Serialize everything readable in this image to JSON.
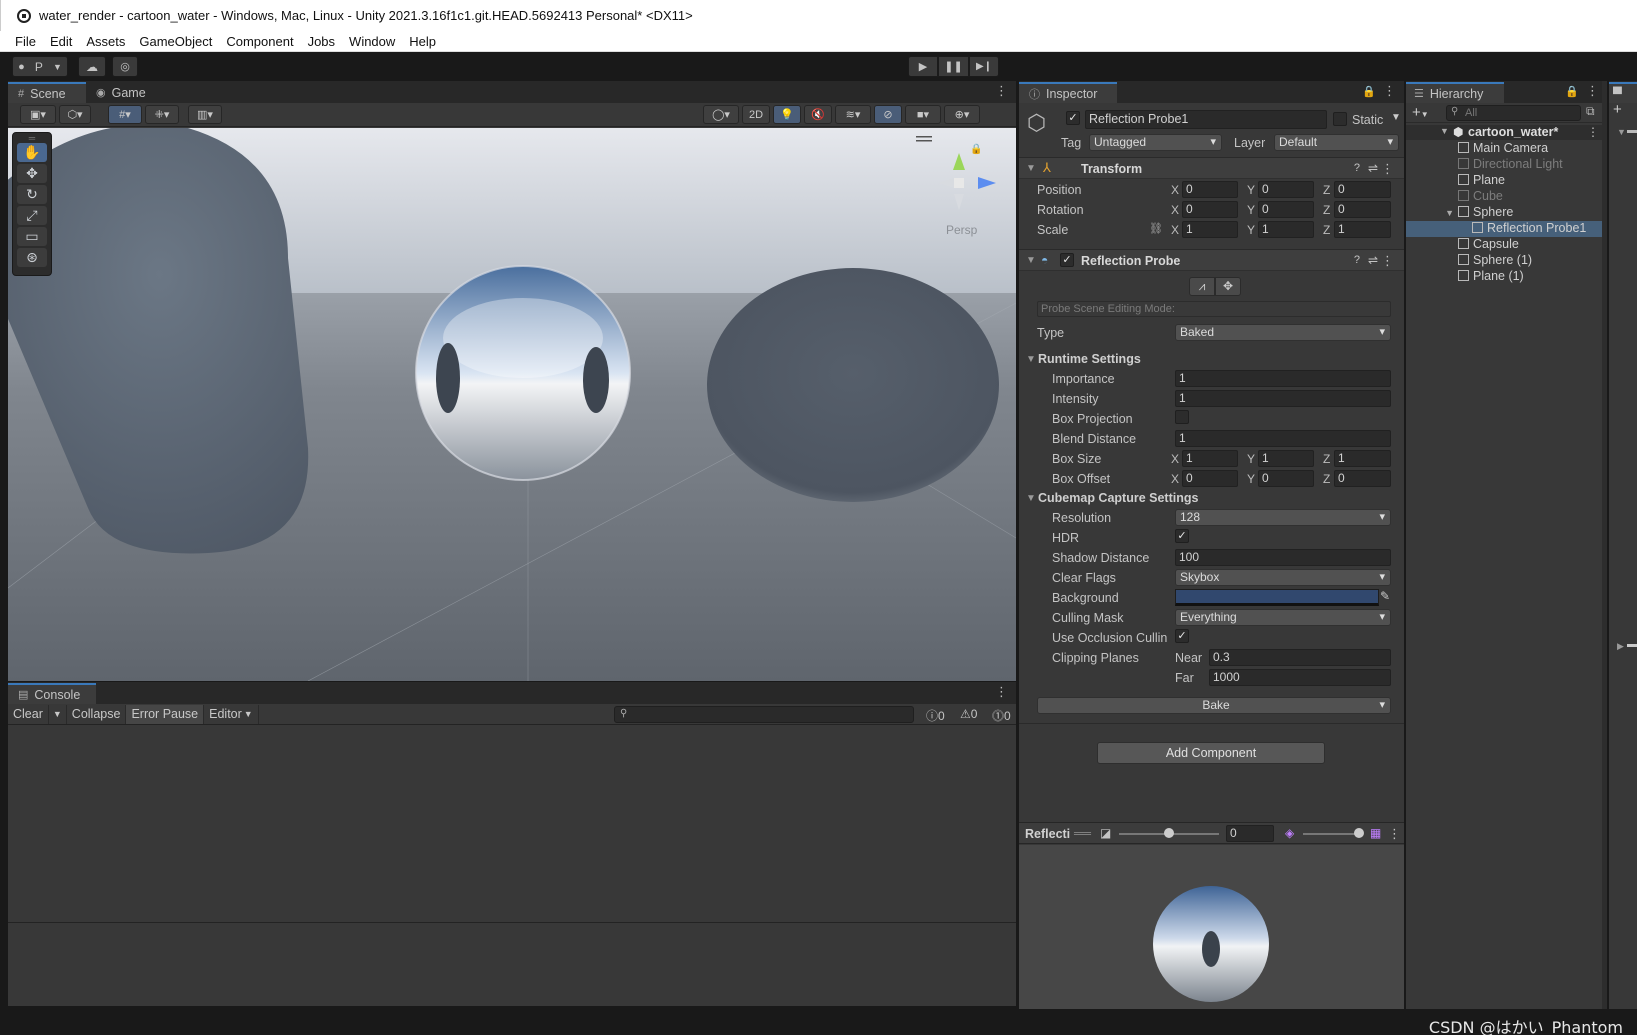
{
  "window": {
    "title": "water_render - cartoon_water - Windows, Mac, Linux - Unity 2021.3.16f1c1.git.HEAD.5692413 Personal* <DX11>"
  },
  "menu": [
    "File",
    "Edit",
    "Assets",
    "GameObject",
    "Component",
    "Jobs",
    "Window",
    "Help"
  ],
  "toolbar": {
    "account": "P",
    "play_icon": "play-icon",
    "pause_icon": "pause-icon",
    "step_icon": "step-icon"
  },
  "scene": {
    "tabs": [
      "Scene",
      "Game"
    ],
    "active_tab": "Scene",
    "toggle_2d": "2D",
    "camera_label": "Persp"
  },
  "console": {
    "tab": "Console",
    "clear": "Clear",
    "collapse": "Collapse",
    "error_pause": "Error Pause",
    "editor": "Editor",
    "search_placeholder": "",
    "log_count": "0",
    "warn_count": "0",
    "error_count": "0"
  },
  "inspector": {
    "tab": "Inspector",
    "object_name": "Reflection Probe1",
    "static_label": "Static",
    "tag_label": "Tag",
    "tag_value": "Untagged",
    "layer_label": "Layer",
    "layer_value": "Default",
    "transform": {
      "title": "Transform",
      "position_label": "Position",
      "rotation_label": "Rotation",
      "scale_label": "Scale",
      "position": {
        "x": "0",
        "y": "0",
        "z": "0"
      },
      "rotation": {
        "x": "0",
        "y": "0",
        "z": "0"
      },
      "scale": {
        "x": "1",
        "y": "1",
        "z": "1"
      }
    },
    "probe": {
      "title": "Reflection Probe",
      "editing_mode": "Probe Scene Editing Mode:",
      "type_label": "Type",
      "type_value": "Baked",
      "runtime_header": "Runtime Settings",
      "importance_label": "Importance",
      "importance": "1",
      "intensity_label": "Intensity",
      "intensity": "1",
      "box_projection_label": "Box Projection",
      "blend_distance_label": "Blend Distance",
      "blend_distance": "1",
      "box_size_label": "Box Size",
      "box_size": {
        "x": "1",
        "y": "1",
        "z": "1"
      },
      "box_offset_label": "Box Offset",
      "box_offset": {
        "x": "0",
        "y": "0",
        "z": "0"
      },
      "cubemap_header": "Cubemap Capture Settings",
      "resolution_label": "Resolution",
      "resolution": "128",
      "hdr_label": "HDR",
      "shadow_distance_label": "Shadow Distance",
      "shadow_distance": "100",
      "clear_flags_label": "Clear Flags",
      "clear_flags": "Skybox",
      "background_label": "Background",
      "background_color": "#31486e",
      "culling_mask_label": "Culling Mask",
      "culling_mask": "Everything",
      "occlusion_label": "Use Occlusion Cullin",
      "clipping_label": "Clipping Planes",
      "near_label": "Near",
      "near": "0.3",
      "far_label": "Far",
      "far": "1000",
      "bake": "Bake"
    },
    "add_component": "Add Component",
    "preview": {
      "title": "Reflecti",
      "mip_value": "0"
    }
  },
  "hierarchy": {
    "tab": "Hierarchy",
    "search_placeholder": "All",
    "scene_name": "cartoon_water*",
    "items": [
      {
        "label": "Main Camera",
        "indent": 1,
        "dim": false
      },
      {
        "label": "Directional Light",
        "indent": 1,
        "dim": true
      },
      {
        "label": "Plane",
        "indent": 1,
        "dim": false
      },
      {
        "label": "Cube",
        "indent": 1,
        "dim": true
      },
      {
        "label": "Sphere",
        "indent": 1,
        "dim": false
      },
      {
        "label": "Reflection Probe1",
        "indent": 2,
        "dim": false
      },
      {
        "label": "Capsule",
        "indent": 1,
        "dim": false
      },
      {
        "label": "Sphere (1)",
        "indent": 1,
        "dim": false
      },
      {
        "label": "Plane (1)",
        "indent": 1,
        "dim": false
      }
    ]
  },
  "watermark": "CSDN @はかい_Phantom"
}
